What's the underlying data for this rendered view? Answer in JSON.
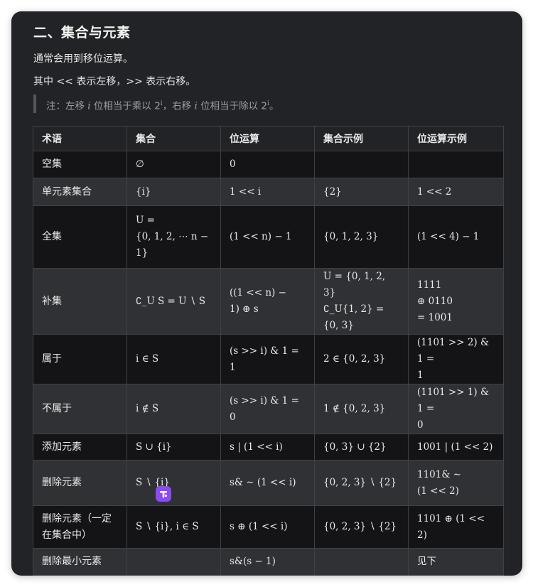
{
  "section": {
    "heading": "二、集合与元素",
    "line1": "通常会用到移位运算。",
    "line2": "其中 << 表示左移，>> 表示右移。"
  },
  "note": {
    "p1": "注：左移 ",
    "var1": "i",
    "p2": " 位相当于乘以 2",
    "sup1": "i",
    "p3": "，右移 ",
    "var2": "i",
    "p4": " 位相当于除以 2",
    "sup2": "i",
    "p5": "。"
  },
  "table": {
    "headers": [
      "术语",
      "集合",
      "位运算",
      "集合示例",
      "位运算示例"
    ],
    "rows": [
      [
        "空集",
        "∅",
        "0",
        "",
        ""
      ],
      [
        "单元素集合",
        "{i}",
        "1 << i",
        "{2}",
        "1 << 2"
      ],
      [
        "全集",
        "U =\n{0, 1, 2, ⋯ n −\n1}",
        "(1 << n) − 1",
        "{0, 1, 2, 3}",
        "(1 << 4) − 1"
      ],
      [
        "补集",
        "∁_U S = U ∖ S",
        "((1 << n) −\n1) ⊕ s",
        "U = {0, 1, 2, 3}\n∁_U{1, 2} =\n{0, 3}",
        "   1111\n⊕ 0110\n= 1001"
      ],
      [
        "属于",
        "i ∈ S",
        "(s >> i) & 1 = 1",
        "2 ∈ {0, 2, 3}",
        "(1101 >> 2) & 1 =\n1"
      ],
      [
        "不属于",
        "i ∉ S",
        "(s >> i) & 1 = 0",
        "1 ∉ {0, 2, 3}",
        "(1101 >> 1) & 1 =\n0"
      ],
      [
        "添加元素",
        "S ∪ {i}",
        "s | (1 << i)",
        "{0, 3} ∪ {2}",
        "1001 | (1 << 2)"
      ],
      [
        "删除元素",
        "S ∖ {i}",
        "s& ∼ (1 << i)",
        "{0, 2, 3} ∖ {2}",
        "1101& ∼\n(1 << 2)"
      ],
      [
        "删除元素（一定\n在集合中）",
        "S ∖ {i}, i ∈ S",
        "s ⊕ (1 << i)",
        "{0, 2, 3} ∖ {2}",
        "1101 ⊕ (1 << 2)"
      ],
      [
        "删除最小元素",
        "",
        "s&(s − 1)",
        "",
        "见下"
      ]
    ]
  },
  "icons": {
    "badge": "translate-badge-icon",
    "badge_color": "#8a4cf0"
  }
}
